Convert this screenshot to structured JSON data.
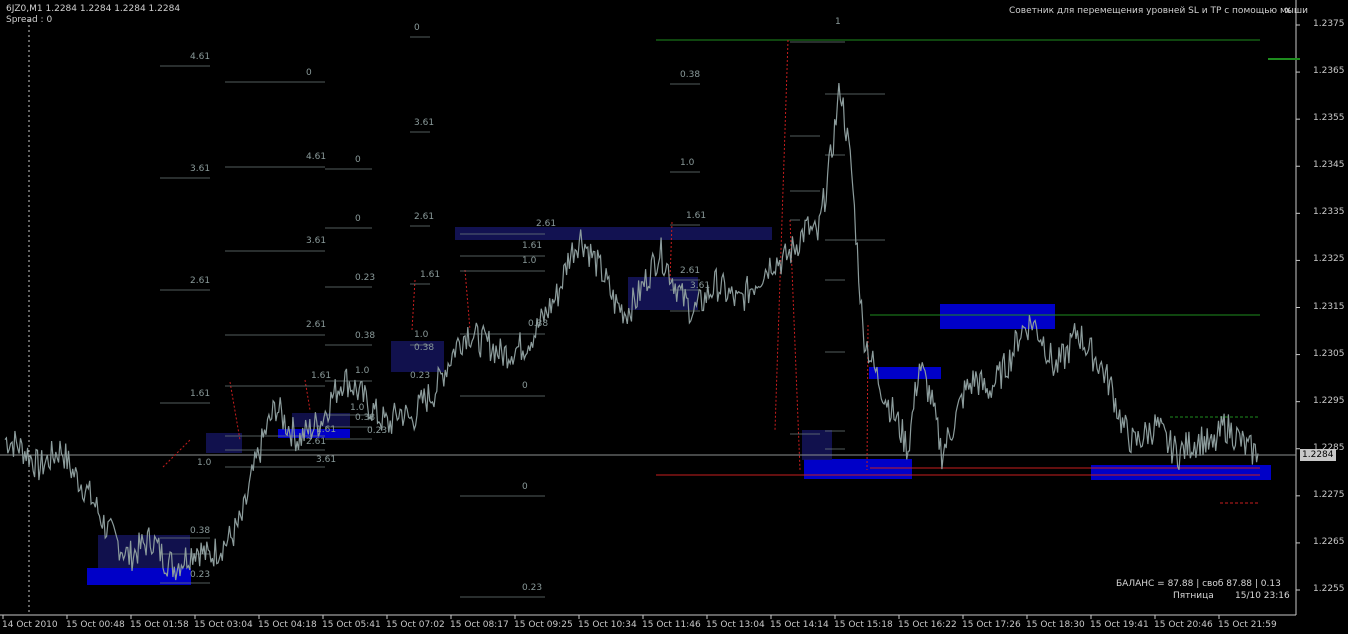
{
  "header": {
    "symbol": "6JZ0,M1",
    "ohlc": "1.2284 1.2284 1.2284 1.2284",
    "spread": "Spread : 0",
    "advisor_title": "Советник для перемещения уровней SL и TP с помощью мыши",
    "close_glyph": "x"
  },
  "price_axis": {
    "labels": [
      "1.2375",
      "1.2365",
      "1.2355",
      "1.2345",
      "1.2335",
      "1.2325",
      "1.2315",
      "1.2305",
      "1.2295",
      "1.2285",
      "1.2275",
      "1.2265",
      "1.2255"
    ],
    "current_price": "1.2284"
  },
  "time_axis": {
    "labels": [
      "14 Oct 2010",
      "15 Oct 00:48",
      "15 Oct 01:58",
      "15 Oct 03:04",
      "15 Oct 04:18",
      "15 Oct 05:41",
      "15 Oct 07:02",
      "15 Oct 08:17",
      "15 Oct 09:25",
      "15 Oct 10:34",
      "15 Oct 11:46",
      "15 Oct 13:04",
      "15 Oct 14:14",
      "15 Oct 15:18",
      "15 Oct 16:22",
      "15 Oct 17:26",
      "15 Oct 18:30",
      "15 Oct 19:41",
      "15 Oct 20:46",
      "15 Oct 21:59"
    ]
  },
  "footer": {
    "balance_line": "БАЛАНС = 87.88 | своб 87.88 | 0.13",
    "day": "Пятница",
    "datetime": "15/10 23:16"
  },
  "fib_labels": [
    "4.61",
    "3.61",
    "2.61",
    "1.61",
    "1.0",
    "0.38",
    "0.23",
    "0",
    "3.61",
    "2.61",
    "1.61",
    "1.0",
    "0.38",
    "0.23",
    "0",
    "4.61",
    "3.61",
    "2.61",
    "1.61",
    "1.0",
    "0.38",
    "0.23",
    "0",
    "0",
    "0.23",
    "0.38",
    "1.0",
    "1.61",
    "2.61",
    "3.61",
    "2.61",
    "1.61",
    "1.0",
    "0.38",
    "0",
    "0",
    "0.23",
    "0.38",
    "1.0",
    "1.61",
    "2.61",
    "3.61",
    "1"
  ],
  "colors": {
    "background": "#000000",
    "candles": "#8c9c9c",
    "zone_blue": "#0000c8",
    "zone_dark": "#14145a",
    "green_line": "#1e8c1e",
    "red_line": "#c81e1e",
    "fib_lines": "#6e7c7c"
  },
  "chart_data": {
    "type": "line",
    "title": "6JZ0,M1",
    "xlabel": "",
    "ylabel": "",
    "ylim": [
      1.2251,
      1.2379
    ],
    "series": [
      {
        "values": [
          1.2287,
          1.2286,
          1.2284,
          1.2281,
          1.2283,
          1.2285,
          1.228,
          1.2277,
          1.2273,
          1.2268,
          1.2265,
          1.2262,
          1.2264,
          1.2266,
          1.2262,
          1.226,
          1.2262,
          1.2264,
          1.2262,
          1.2264,
          1.2266,
          1.227,
          1.228,
          1.2288,
          1.2294,
          1.229,
          1.2287,
          1.2289,
          1.2291,
          1.2296,
          1.23,
          1.2298,
          1.2295,
          1.2292,
          1.229,
          1.2293,
          1.2291,
          1.2295,
          1.2297,
          1.2302,
          1.2307,
          1.231,
          1.2308,
          1.2307,
          1.2305,
          1.2306,
          1.2307,
          1.231,
          1.2314,
          1.2318,
          1.2326,
          1.233,
          1.2326,
          1.2322,
          1.2316,
          1.2314,
          1.2317,
          1.2322,
          1.2327,
          1.2322,
          1.2317,
          1.2314,
          1.2317,
          1.232,
          1.2318,
          1.2316,
          1.2319,
          1.2322,
          1.2325,
          1.2325,
          1.2328,
          1.2332,
          1.233,
          1.2344,
          1.2362,
          1.2344,
          1.231,
          1.2302,
          1.2296,
          1.2291,
          1.2285,
          1.2303,
          1.2296,
          1.2284,
          1.229,
          1.2297,
          1.23,
          1.2297,
          1.23,
          1.2304,
          1.231,
          1.2312,
          1.2308,
          1.2302,
          1.2305,
          1.231,
          1.2306,
          1.2303,
          1.2298,
          1.229,
          1.2286,
          1.2288,
          1.229,
          1.2286,
          1.2284,
          1.2286,
          1.2287,
          1.2285,
          1.229,
          1.2288,
          1.2285,
          1.2284
        ]
      }
    ]
  }
}
